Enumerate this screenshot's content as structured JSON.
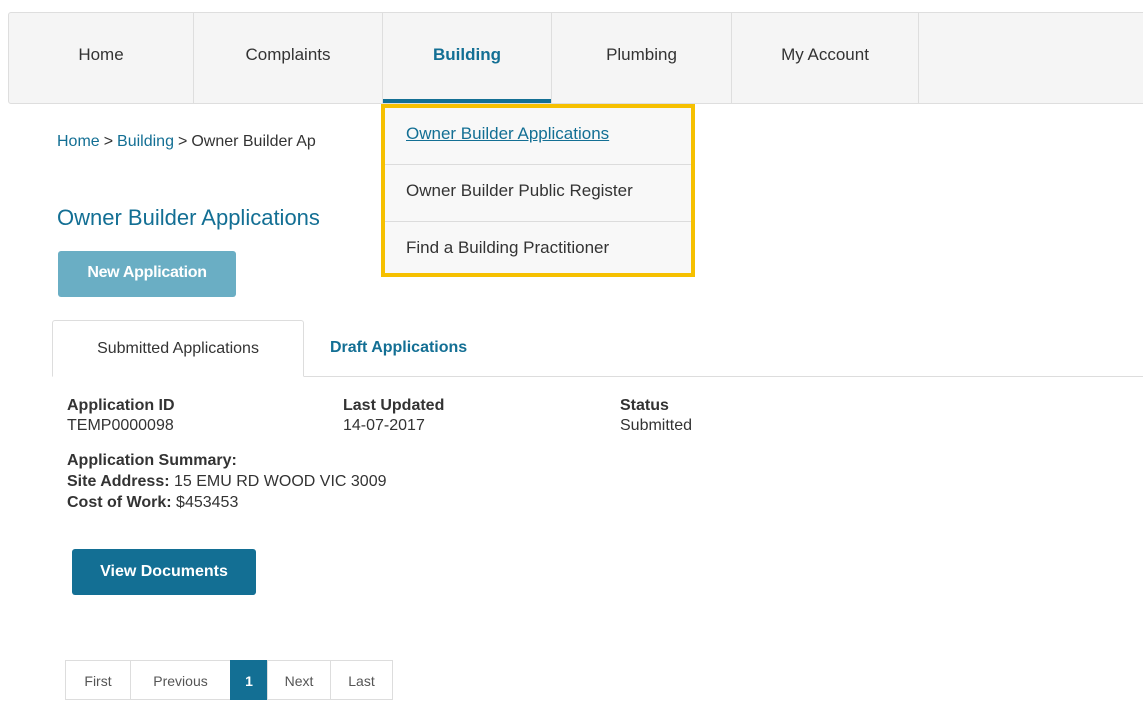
{
  "nav": {
    "items": [
      {
        "label": "Home"
      },
      {
        "label": "Complaints"
      },
      {
        "label": "Building"
      },
      {
        "label": "Plumbing"
      },
      {
        "label": "My Account"
      }
    ],
    "active": "Building"
  },
  "breadcrumb": {
    "home": "Home",
    "sep1": ">",
    "building": "Building",
    "sep2": ">",
    "current": "Owner Builder Ap"
  },
  "dropdown": {
    "items": [
      {
        "label": "Owner Builder Applications"
      },
      {
        "label": "Owner Builder Public Register"
      },
      {
        "label": "Find a Building Practitioner"
      }
    ],
    "highlight_color": "#f6c000"
  },
  "page": {
    "title": "Owner Builder Applications",
    "new_button": "New Application"
  },
  "tabs": {
    "submitted": "Submitted Applications",
    "draft": "Draft Applications"
  },
  "application": {
    "id_label": "Application ID",
    "id_value": "TEMP0000098",
    "updated_label": "Last Updated",
    "updated_value": "14-07-2017",
    "status_label": "Status",
    "status_value": "Submitted",
    "summary_label": "Application Summary:",
    "site_label": "Site Address:",
    "site_value": "15 EMU RD WOOD VIC 3009",
    "cost_label": "Cost of Work:",
    "cost_value": "$453453",
    "docs_button": "View Documents"
  },
  "pagination": {
    "first": "First",
    "previous": "Previous",
    "current": "1",
    "next": "Next",
    "last": "Last"
  },
  "colors": {
    "brand": "#136f94",
    "button_light": "#6aaec4"
  }
}
